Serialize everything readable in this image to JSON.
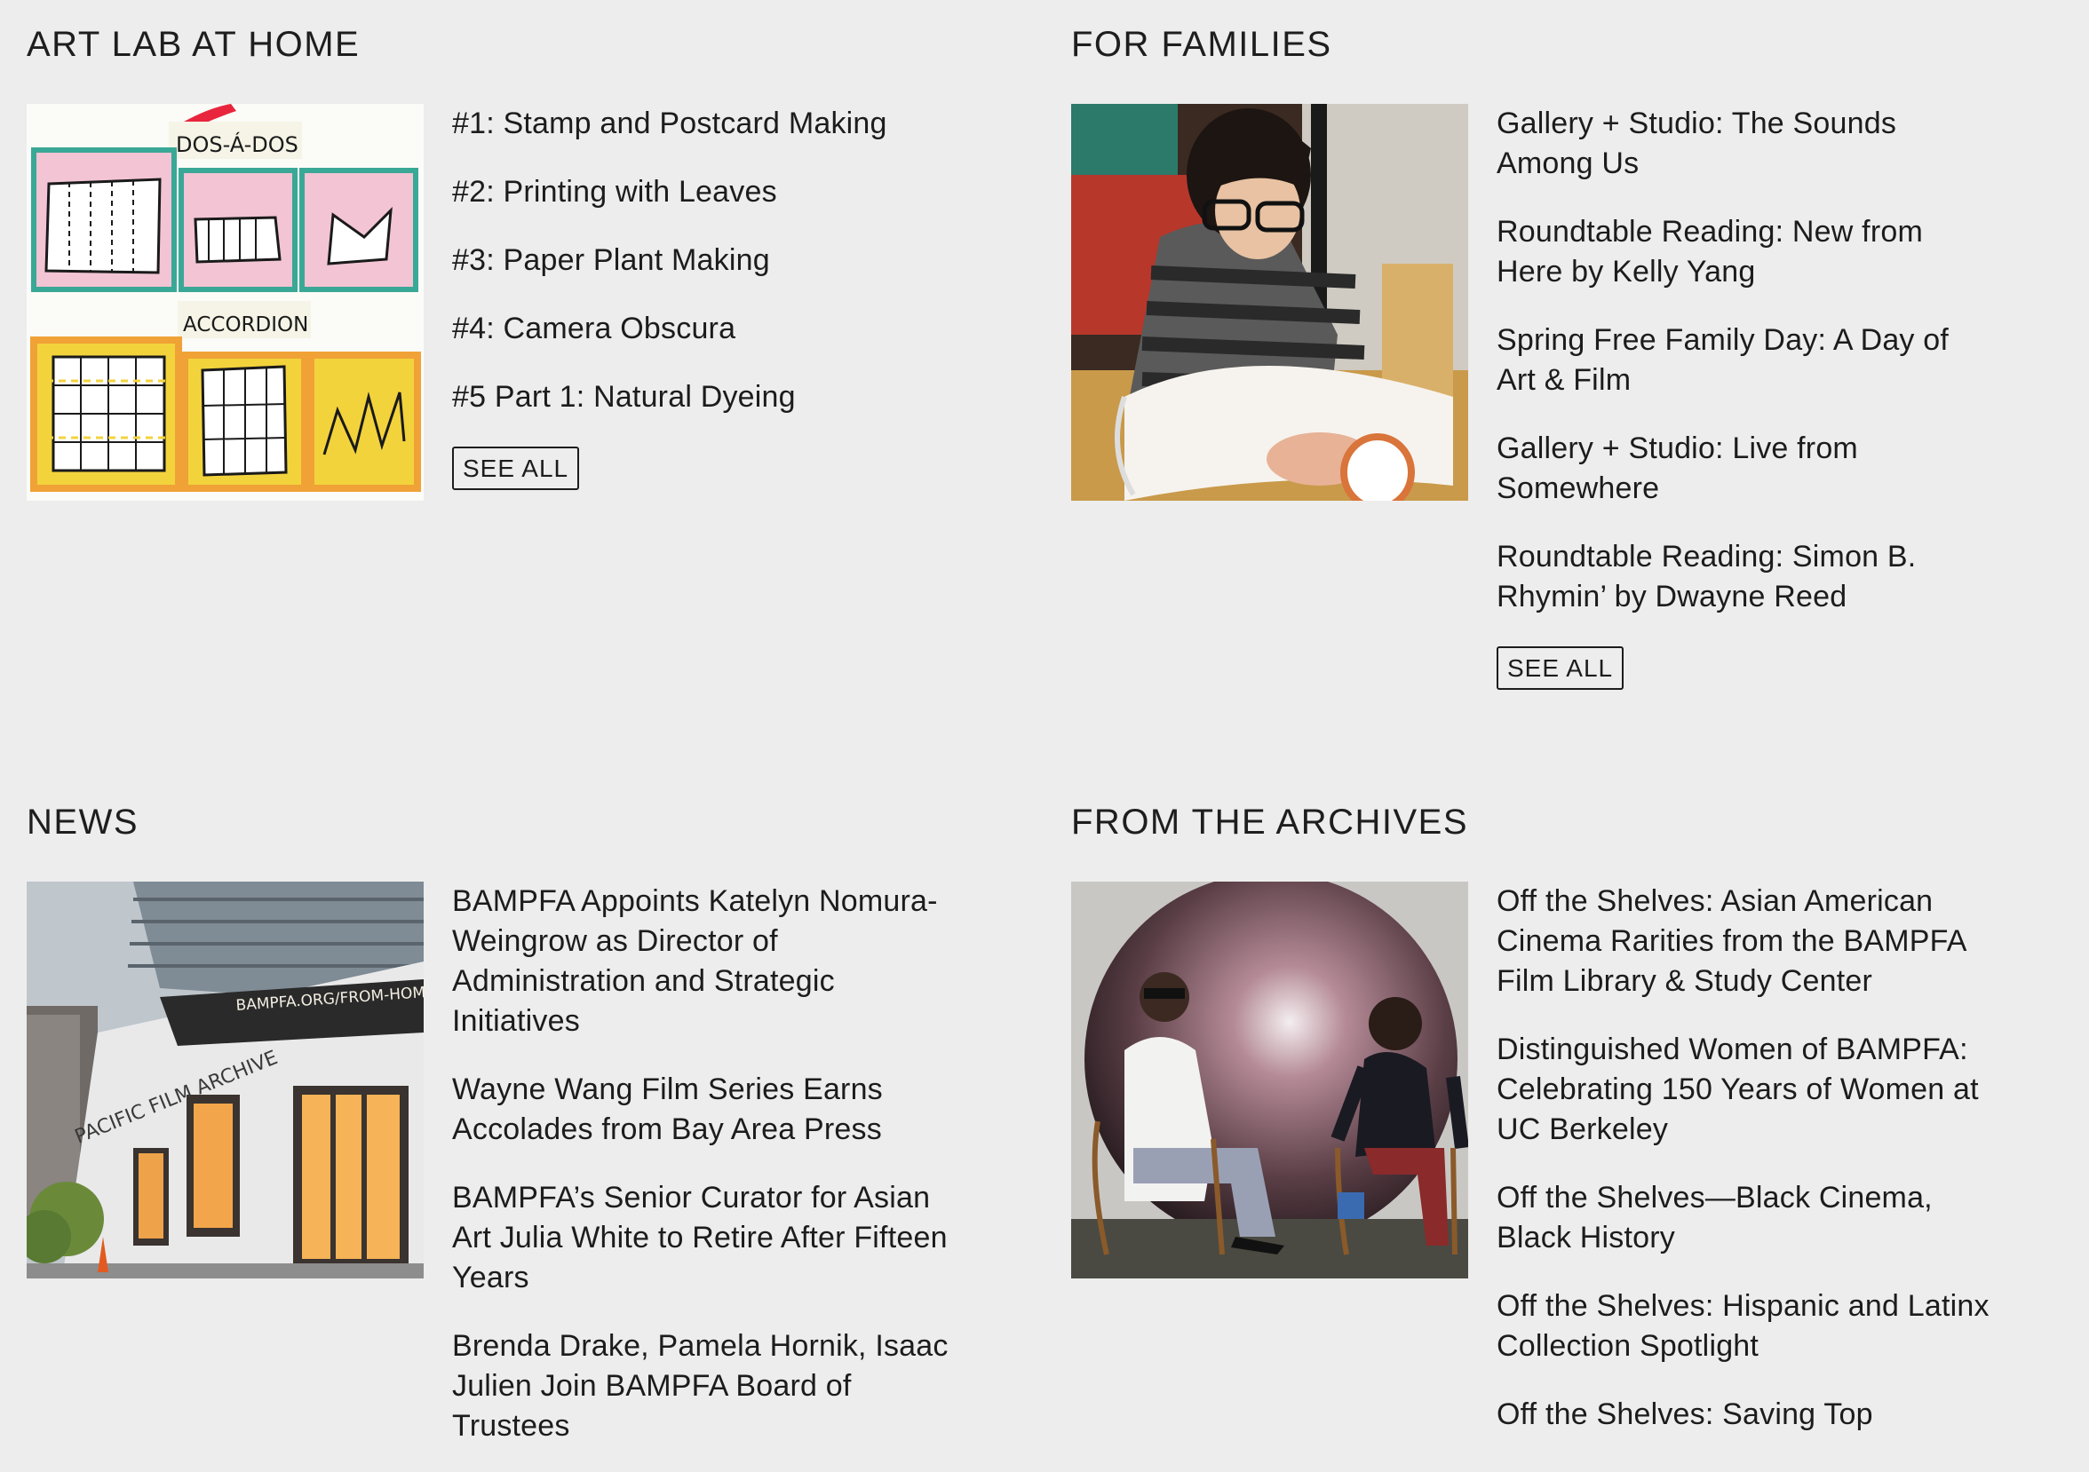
{
  "sections": {
    "art_lab": {
      "title": "ART LAB AT HOME",
      "image_text": {
        "top": "DOS-Á-DOS",
        "middle": "ACCORDION"
      },
      "links": [
        "#1: Stamp and Postcard Making",
        "#2: Printing with Leaves",
        "#3: Paper Plant Making",
        "#4: Camera Obscura",
        "#5 Part 1: Natural Dyeing"
      ],
      "see_all": "SEE ALL"
    },
    "families": {
      "title": "FOR FAMILIES",
      "links": [
        "Gallery + Studio: The Sounds Among Us",
        "Roundtable Reading: New from Here by Kelly Yang",
        "Spring Free Family Day: A Day of Art & Film",
        "Gallery + Studio: Live from Somewhere",
        "Roundtable Reading: Simon B. Rhymin’ by Dwayne Reed"
      ],
      "see_all": "SEE ALL"
    },
    "news": {
      "title": "NEWS",
      "image_text": {
        "sign": "BAMPFA.ORG/FROM-HOME",
        "facade": "PACIFIC FILM ARCHIVE"
      },
      "links": [
        "BAMPFA Appoints Katelyn Nomura-Weingrow as Director of Administration and Strategic Initiatives",
        "Wayne Wang Film Series Earns Accolades from Bay Area Press",
        "BAMPFA’s Senior Curator for Asian Art Julia White to Retire After Fifteen Years",
        "Brenda Drake, Pamela Hornik, Isaac Julien Join BAMPFA Board of Trustees"
      ]
    },
    "archives": {
      "title": "FROM THE ARCHIVES",
      "links": [
        "Off the Shelves: Asian American Cinema Rarities from the BAMPFA Film Library & Study Center",
        "Distinguished Women of BAMPFA: Celebrating 150 Years of Women at UC Berkeley",
        "Off the Shelves—Black Cinema, Black History",
        "Off the Shelves: Hispanic and Latinx Collection Spotlight",
        "Off the Shelves: Saving Top"
      ]
    }
  },
  "colors": {
    "background": "#ededed",
    "text": "#1c1c1c",
    "pink": "#f2c4d4",
    "teal": "#3aa896",
    "yellow": "#f3d33c",
    "orange": "#f0a236"
  }
}
